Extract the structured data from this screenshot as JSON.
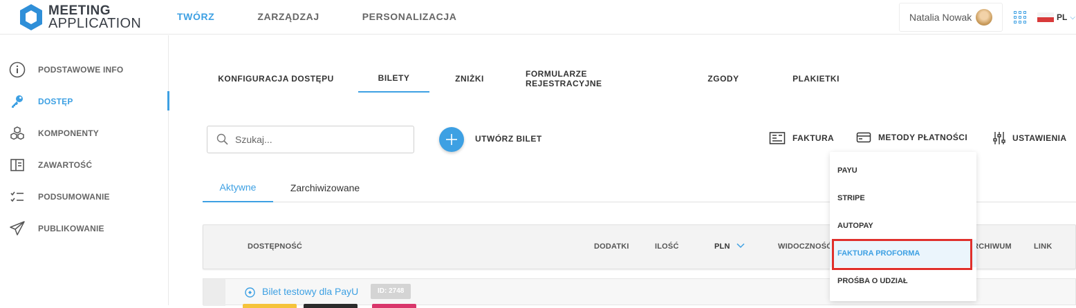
{
  "app": {
    "logo_line1": "MEETING",
    "logo_line2": "APPLICATION",
    "brand_color": "#3da0e3"
  },
  "topnav": {
    "items": [
      {
        "label": "TWÓRZ",
        "active": true
      },
      {
        "label": "ZARZĄDZAJ"
      },
      {
        "label": "PERSONALIZACJA"
      }
    ]
  },
  "user": {
    "name": "Natalia Nowak"
  },
  "language": {
    "code": "PL"
  },
  "sidebar": {
    "items": [
      {
        "label": "PODSTAWOWE INFO",
        "icon": "info-icon"
      },
      {
        "label": "DOSTĘP",
        "icon": "key-icon",
        "active": true
      },
      {
        "label": "KOMPONENTY",
        "icon": "cubes-icon"
      },
      {
        "label": "ZAWARTOŚĆ",
        "icon": "book-icon"
      },
      {
        "label": "PODSUMOWANIE",
        "icon": "checklist-icon"
      },
      {
        "label": "PUBLIKOWANIE",
        "icon": "paper-plane-icon"
      }
    ]
  },
  "tabs": [
    {
      "label": "KONFIGURACJA DOSTĘPU"
    },
    {
      "label": "BILETY",
      "active": true
    },
    {
      "label": "ZNIŻKI"
    },
    {
      "label": "FORMULARZE REJESTRACYJNE"
    },
    {
      "label": "ZGODY"
    },
    {
      "label": "PLAKIETKI"
    }
  ],
  "toolbar": {
    "search_placeholder": "Szukaj...",
    "create_label": "UTWÓRZ BILET",
    "invoice_label": "FAKTURA",
    "payment_methods_label": "METODY PŁATNOŚCI",
    "settings_label": "USTAWIENIA"
  },
  "subtabs": [
    {
      "label": "Aktywne",
      "active": true
    },
    {
      "label": "Zarchiwizowane"
    }
  ],
  "table": {
    "headers": {
      "availability": "DOSTĘPNOŚĆ",
      "addons": "DODATKI",
      "quantity": "ILOŚĆ",
      "currency": "PLN",
      "visibility": "WIDOCZNOŚĆ",
      "archive": "ARCHIWUM",
      "link": "LINK"
    },
    "rows": [
      {
        "title": "Bilet testowy dla PayU",
        "id": "ID: 2748"
      }
    ]
  },
  "payment_dropdown": {
    "items": [
      {
        "label": "PAYU"
      },
      {
        "label": "STRIPE"
      },
      {
        "label": "AUTOPAY"
      },
      {
        "label": "FAKTURA PROFORMA",
        "highlighted": true
      },
      {
        "label": "PROŚBA O UDZIAŁ"
      }
    ]
  }
}
